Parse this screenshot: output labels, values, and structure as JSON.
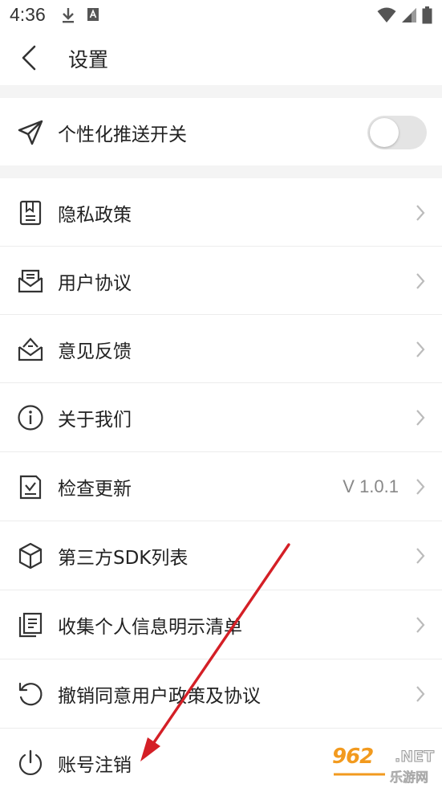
{
  "status_bar": {
    "time": "4:36",
    "left_icons": [
      "download-icon",
      "keyboard-a-icon"
    ],
    "right_icons": [
      "wifi-icon",
      "signal-icon",
      "battery-icon"
    ]
  },
  "header": {
    "title": "设置"
  },
  "toggle_row": {
    "label": "个性化推送开关",
    "icon": "paper-plane-icon",
    "enabled": false
  },
  "menu": {
    "items": [
      {
        "label": "隐私政策",
        "icon": "document-icon"
      },
      {
        "label": "用户协议",
        "icon": "envelope-open-icon"
      },
      {
        "label": "意见反馈",
        "icon": "feedback-mail-icon"
      },
      {
        "label": "关于我们",
        "icon": "info-icon"
      },
      {
        "label": "检查更新",
        "icon": "update-check-icon",
        "value": "V 1.0.1"
      },
      {
        "label": "第三方SDK列表",
        "icon": "cube-icon"
      },
      {
        "label": "收集个人信息明示清单",
        "icon": "list-document-icon"
      },
      {
        "label": "撤销同意用户政策及协议",
        "icon": "revoke-icon"
      },
      {
        "label": "账号注销",
        "icon": "power-icon"
      }
    ]
  },
  "watermark": {
    "logo": "962",
    "suffix": ".NET",
    "sub": "乐游网"
  },
  "colors": {
    "annotation_arrow": "#d41f26",
    "toggle_off": "#e4e4e4",
    "section_band": "#f4f4f4",
    "watermark_orange": "#f29a1e"
  }
}
